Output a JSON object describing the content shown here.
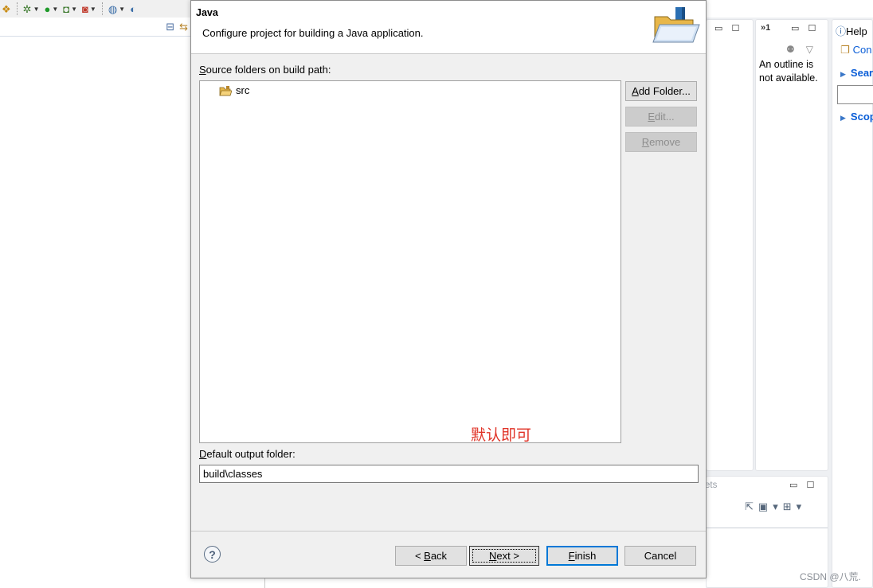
{
  "workbench": {
    "outline_message": "An outline is not available.",
    "outline_tab": "»1",
    "help_view": {
      "title": "Help",
      "contents_link": "Con",
      "search_link": "Searc",
      "scope_link": "Scop"
    },
    "bottom_view_tab": "ets",
    "watermark": "CSDN @八荒."
  },
  "dialog": {
    "title": "Java",
    "description": "Configure project for building a Java application.",
    "source_folders_label": {
      "mnemonic": "S",
      "rest": "ource folders on build path:"
    },
    "source_folders": [
      {
        "name": "src",
        "icon": "package-folder-icon"
      }
    ],
    "buttons": {
      "add_folder": {
        "mnemonic": "A",
        "rest": "dd Folder..."
      },
      "edit": {
        "mnemonic": "E",
        "rest": "dit..."
      },
      "remove": {
        "mnemonic": "R",
        "rest": "emove"
      },
      "back": {
        "prefix": "< ",
        "mnemonic": "B",
        "rest": "ack"
      },
      "next": {
        "mnemonic": "N",
        "rest": "ext >"
      },
      "finish": {
        "mnemonic": "F",
        "rest": "inish"
      },
      "cancel": "Cancel"
    },
    "output_folder_label": {
      "mnemonic": "D",
      "rest": "efault output folder:"
    },
    "output_folder_value": "build\\classes",
    "annotation": "默认即可",
    "help_icon": "?"
  },
  "colors": {
    "annotation": "#e03428",
    "default_button_border": "#0078d7"
  }
}
